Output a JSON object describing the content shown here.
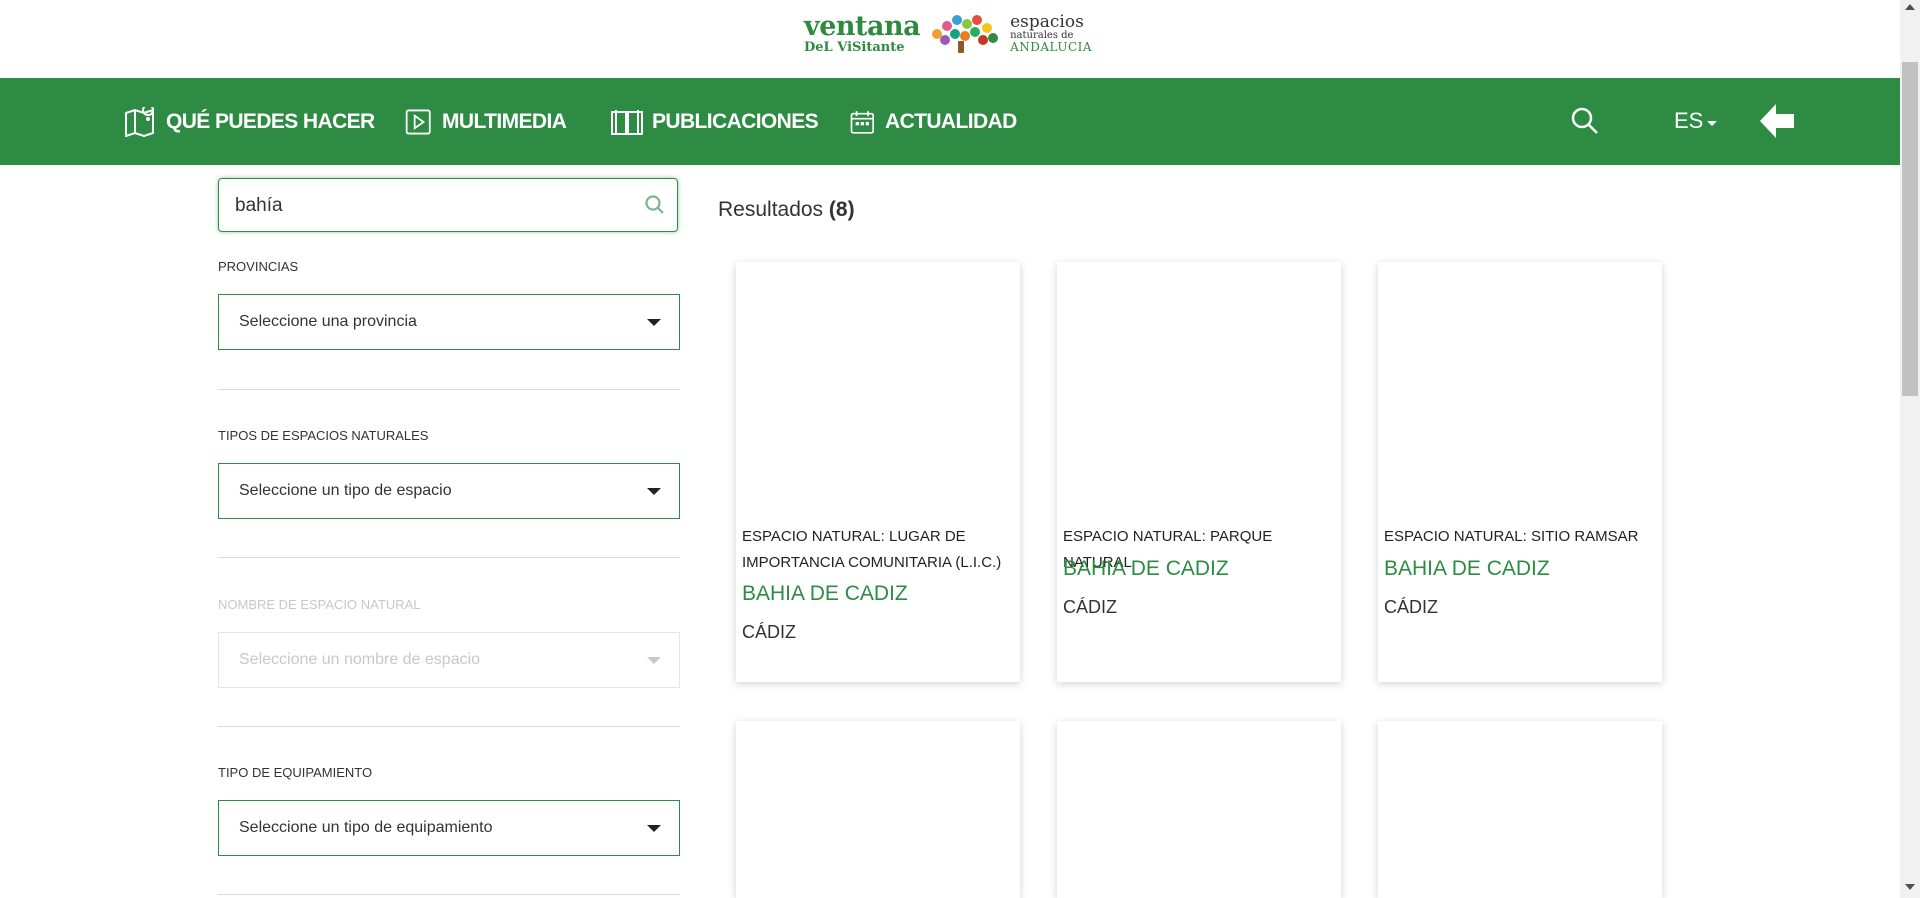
{
  "header": {
    "logo": {
      "line1": "ventana",
      "line2": "DeL ViSitante",
      "right1": "espacios",
      "right2": "naturales de",
      "right3": "ANDALUCIA"
    }
  },
  "nav": {
    "items": [
      {
        "label": "QUÉ PUEDES HACER",
        "icon": "map-pin-icon"
      },
      {
        "label": "MULTIMEDIA",
        "icon": "play-icon"
      },
      {
        "label": "PUBLICACIONES",
        "icon": "book-icon"
      },
      {
        "label": "ACTUALIDAD",
        "icon": "calendar-icon"
      }
    ],
    "language": "ES"
  },
  "filters": {
    "search_value": "bahía",
    "provincias": {
      "label": "PROVINCIAS",
      "value": "Seleccione una provincia"
    },
    "tipos": {
      "label": "TIPOS DE ESPACIOS NATURALES",
      "value": "Seleccione un tipo de espacio"
    },
    "nombre": {
      "label": "NOMBRE DE ESPACIO NATURAL",
      "value": "Seleccione un nombre de espacio",
      "disabled": true
    },
    "equipamiento": {
      "label": "TIPO DE EQUIPAMIENTO",
      "value": "Seleccione un tipo de equipamiento"
    }
  },
  "results": {
    "label": "Resultados",
    "count": "(8)",
    "cards": [
      {
        "type": "ESPACIO NATURAL: LUGAR DE IMPORTANCIA COMUNITARIA (L.I.C.)",
        "name": "BAHIA DE CADIZ",
        "province": "CÁDIZ"
      },
      {
        "type": "ESPACIO NATURAL: PARQUE NATURAL",
        "name": "BAHIA DE CADIZ",
        "province": "CÁDIZ"
      },
      {
        "type": "ESPACIO NATURAL: SITIO RAMSAR",
        "name": "BAHIA DE CADIZ",
        "province": "CÁDIZ"
      }
    ]
  },
  "colors": {
    "brand_green": "#2e8b44",
    "text": "#333333"
  }
}
